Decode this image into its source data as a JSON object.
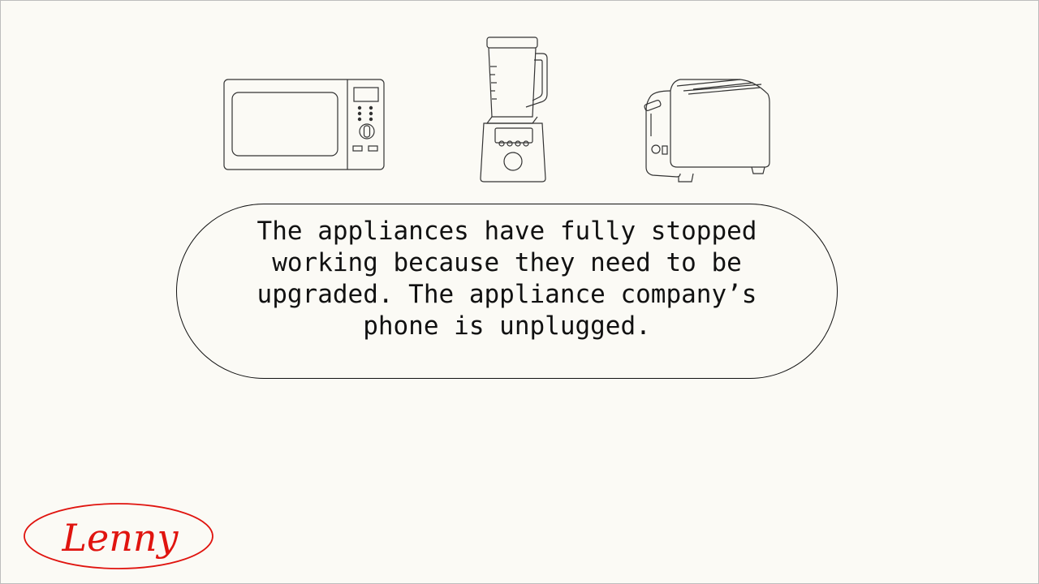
{
  "slide": {
    "message": "The appliances have fully stopped working because they need to be upgraded. The appliance company’s phone is unplugged."
  },
  "appliances": [
    {
      "name": "microwave",
      "icon": "microwave-icon"
    },
    {
      "name": "blender",
      "icon": "blender-icon"
    },
    {
      "name": "toaster",
      "icon": "toaster-icon"
    }
  ],
  "logo": {
    "text": "Lenny",
    "color": "#e0140f"
  },
  "colors": {
    "background": "#fbfaf5",
    "ink": "#111111",
    "accent": "#e0140f"
  }
}
